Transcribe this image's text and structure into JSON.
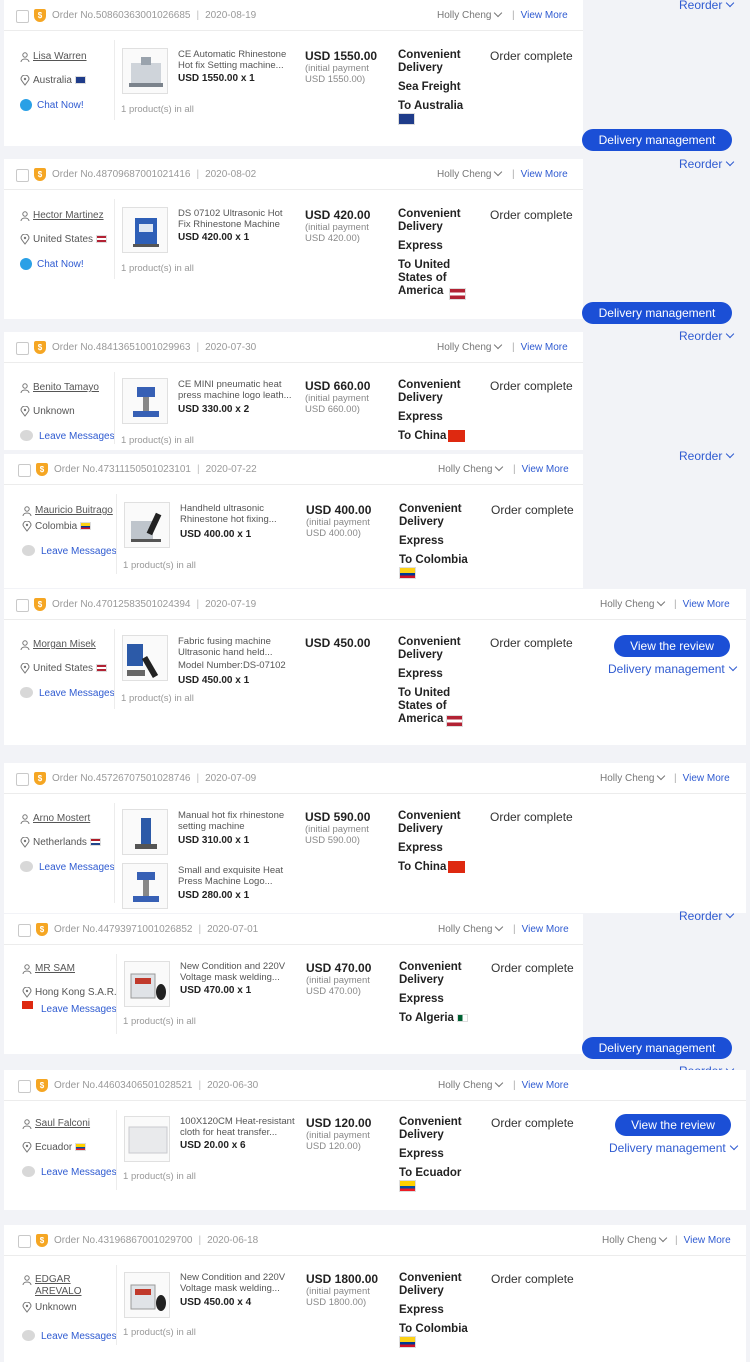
{
  "labels": {
    "order_prefix": "Order No.",
    "initial_payment_prefix": "(initial payment",
    "view_more": "View More",
    "chat_now": "Chat Now!",
    "leave_messages": "Leave Messages",
    "products_suffix": "product(s) in all",
    "reorder": "Reorder",
    "delivery_management": "Delivery management",
    "view_the_review": "View the review",
    "shipping_service": "Convenient Delivery",
    "status_complete": "Order complete",
    "assignee": "Holly Cheng"
  },
  "orders": [
    {
      "order_no": "50860363001026685",
      "date": "2020-08-19",
      "customer": "Lisa Warren",
      "location": "Australia",
      "flag": "au",
      "product_title": "CE Automatic Rhinestone Hot fix Setting machine...",
      "qty_line": "USD 1550.00 x 1",
      "price": "USD 1550.00",
      "initial": "USD 1550.00)",
      "count": "1",
      "mode": "Sea Freight",
      "dest": "To Australia",
      "dest_flag": "au"
    },
    {
      "order_no": "48709687001021416",
      "date": "2020-08-02",
      "customer": "Hector Martinez",
      "location": "United States",
      "flag": "us",
      "product_title": "DS 07102 Ultrasonic Hot Fix Rhinestone Machine",
      "qty_line": "USD 420.00 x 1",
      "price": "USD 420.00",
      "initial": "USD 420.00)",
      "count": "1",
      "mode": "Express",
      "dest": "To United States of America",
      "dest_flag": "us"
    },
    {
      "order_no": "48413651001029963",
      "date": "2020-07-30",
      "customer": "Benito Tamayo",
      "location": "Unknown",
      "flag": "",
      "product_title": "CE MINI pneumatic heat press machine logo leath...",
      "qty_line": "USD 330.00 x 2",
      "price": "USD 660.00",
      "initial": "USD 660.00)",
      "count": "1",
      "mode": "Express",
      "dest": "To China",
      "dest_flag": "cn"
    },
    {
      "order_no": "47311150501023101",
      "date": "2020-07-22",
      "customer": "Mauricio Buitrago",
      "location": "Colombia",
      "flag": "co",
      "product_title": "Handheld ultrasonic Rhinestone hot fixing...",
      "qty_line": "USD 400.00 x 1",
      "price": "USD 400.00",
      "initial": "USD 400.00)",
      "count": "1",
      "mode": "Express",
      "dest": "To Colombia",
      "dest_flag": "co"
    },
    {
      "order_no": "47012583501024394",
      "date": "2020-07-19",
      "customer": "Morgan Misek",
      "location": "United States",
      "flag": "us",
      "product_title": "Fabric fusing machine Ultrasonic hand held...",
      "product_sub": "Model Number:DS-07102",
      "qty_line": "USD 450.00 x 1",
      "price": "USD 450.00",
      "count": "1",
      "mode": "Express",
      "dest": "To United States of America",
      "dest_flag": "us"
    },
    {
      "order_no": "45726707501028746",
      "date": "2020-07-09",
      "customer": "Arno Mostert",
      "location": "Netherlands",
      "flag": "nl",
      "product_title": "Manual hot fix rhinestone setting machine",
      "qty_line": "USD 310.00 x 1",
      "product2_title": "Small and exquisite Heat Press Machine Logo...",
      "qty2_line": "USD 280.00 x 1",
      "price": "USD 590.00",
      "initial": "USD 590.00)",
      "mode": "Express",
      "dest": "To China",
      "dest_flag": "cn"
    },
    {
      "order_no": "44793971001026852",
      "date": "2020-07-01",
      "customer": "MR SAM",
      "location": "Hong Kong S.A.R.",
      "flag": "hk",
      "product_title": "New Condition and 220V Voltage mask welding...",
      "qty_line": "USD 470.00 x 1",
      "price": "USD 470.00",
      "initial": "USD 470.00)",
      "count": "1",
      "mode": "Express",
      "dest": "To Algeria",
      "dest_flag": "dz"
    },
    {
      "order_no": "44603406501028521",
      "date": "2020-06-30",
      "customer": "Saul Falconi",
      "location": "Ecuador",
      "flag": "ec",
      "product_title": "100X120CM Heat-resistant cloth for heat transfer...",
      "qty_line": "USD 20.00 x 6",
      "price": "USD 120.00",
      "initial": "USD 120.00)",
      "count": "1",
      "mode": "Express",
      "dest": "To Ecuador",
      "dest_flag": "ec"
    },
    {
      "order_no": "43196867001029700",
      "date": "2020-06-18",
      "customer": "EDGAR AREVALO",
      "location": "Unknown",
      "flag": "",
      "product_title": "New Condition and 220V Voltage mask welding...",
      "qty_line": "USD 450.00 x 4",
      "price": "USD 1800.00",
      "initial": "USD 1800.00)",
      "count": "1",
      "mode": "Express",
      "dest": "To Colombia",
      "dest_flag": "co"
    }
  ]
}
